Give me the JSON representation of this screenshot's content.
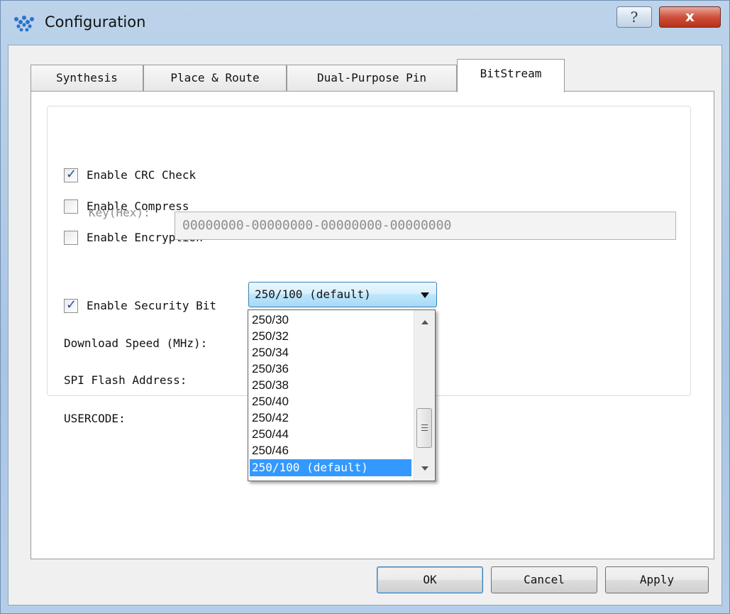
{
  "window": {
    "title": "Configuration",
    "help_label": "?",
    "close_label": "x"
  },
  "tabs": [
    {
      "label": "Synthesis",
      "active": false
    },
    {
      "label": "Place & Route",
      "active": false
    },
    {
      "label": "Dual-Purpose Pin",
      "active": false
    },
    {
      "label": "BitStream",
      "active": true
    }
  ],
  "bitstream": {
    "enable_crc_check": {
      "label": "Enable CRC Check",
      "checked": true
    },
    "enable_compress": {
      "label": "Enable Compress",
      "checked": false
    },
    "enable_encryption": {
      "label": "Enable Encryption",
      "checked": false
    },
    "key_label": "Key(Hex):",
    "key_value": "00000000-00000000-00000000-00000000",
    "enable_security_bit": {
      "label": "Enable Security Bit",
      "checked": true
    },
    "download_speed_label": "Download Speed (MHz):",
    "download_speed_value": "250/100 (default)",
    "spi_flash_label": "SPI Flash Address:",
    "usercode_label": "USERCODE:"
  },
  "dropdown": {
    "options": [
      "250/30",
      "250/32",
      "250/34",
      "250/36",
      "250/38",
      "250/40",
      "250/42",
      "250/44",
      "250/46",
      "250/100 (default)"
    ],
    "selected_index": 9
  },
  "buttons": {
    "ok": "OK",
    "cancel": "Cancel",
    "apply": "Apply"
  },
  "colors": {
    "selection": "#3399ff",
    "title_bar": "#bcd3ea",
    "close_button": "#c8432c"
  }
}
